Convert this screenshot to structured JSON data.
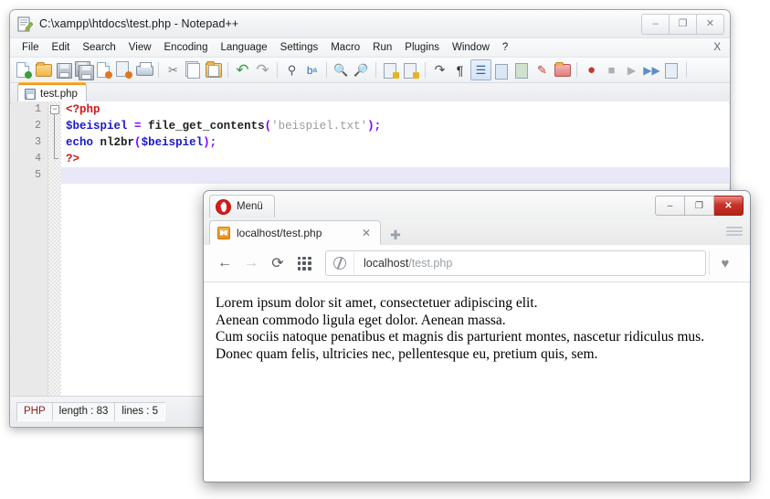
{
  "notepad": {
    "title": "C:\\xampp\\htdocs\\test.php - Notepad++",
    "app_icon": "notepad-plus-plus-icon",
    "window_controls": {
      "minimize": "–",
      "maximize": "❐",
      "close": "✕"
    },
    "menu": [
      {
        "label": "File"
      },
      {
        "label": "Edit"
      },
      {
        "label": "Search"
      },
      {
        "label": "View"
      },
      {
        "label": "Encoding"
      },
      {
        "label": "Language"
      },
      {
        "label": "Settings"
      },
      {
        "label": "Macro"
      },
      {
        "label": "Run"
      },
      {
        "label": "Plugins"
      },
      {
        "label": "Window"
      },
      {
        "label": "?"
      }
    ],
    "menu_close_label": "X",
    "toolbar_icons": [
      "new-file-icon",
      "open-file-icon",
      "save-icon",
      "save-all-icon",
      "close-file-icon",
      "close-all-files-icon",
      "print-icon",
      "cut-icon",
      "copy-icon",
      "paste-icon",
      "undo-icon",
      "redo-icon",
      "find-icon",
      "replace-icon",
      "zoom-in-icon",
      "zoom-out-icon",
      "sync-vertical-scroll-icon",
      "sync-horizontal-scroll-icon",
      "word-wrap-icon",
      "show-all-characters-icon",
      "indent-guide-icon",
      "user-defined-dialog-icon",
      "show-document-map-icon",
      "function-list-icon",
      "folder-as-workspace-icon",
      "record-macro-icon",
      "stop-recording-icon",
      "play-macro-icon",
      "run-macro-multiple-icon",
      "save-macro-icon"
    ],
    "tabs": [
      {
        "label": "test.php",
        "icon": "saved-file-icon",
        "active": true
      }
    ],
    "editor": {
      "line_numbers": [
        "1",
        "2",
        "3",
        "4",
        "5"
      ],
      "fold_marker": "−",
      "lines": [
        {
          "n": 1,
          "tokens": [
            {
              "t": "<?php",
              "c": "c-tag"
            }
          ]
        },
        {
          "n": 2,
          "tokens": [
            {
              "t": "$beispiel",
              "c": "c-var"
            },
            {
              "t": " ",
              "c": "c-plain"
            },
            {
              "t": "=",
              "c": "c-op"
            },
            {
              "t": " ",
              "c": "c-plain"
            },
            {
              "t": "file_get_contents",
              "c": "c-fn"
            },
            {
              "t": "(",
              "c": "c-punc"
            },
            {
              "t": "'beispiel.txt'",
              "c": "c-str"
            },
            {
              "t": ")",
              "c": "c-punc"
            },
            {
              "t": ";",
              "c": "c-punc"
            }
          ]
        },
        {
          "n": 3,
          "tokens": [
            {
              "t": "echo",
              "c": "c-kw"
            },
            {
              "t": " ",
              "c": "c-plain"
            },
            {
              "t": "nl2br",
              "c": "c-fn"
            },
            {
              "t": "(",
              "c": "c-punc"
            },
            {
              "t": "$beispiel",
              "c": "c-var"
            },
            {
              "t": ")",
              "c": "c-punc"
            },
            {
              "t": ";",
              "c": "c-punc"
            }
          ]
        },
        {
          "n": 4,
          "tokens": [
            {
              "t": "?>",
              "c": "c-tag"
            }
          ]
        },
        {
          "n": 5,
          "tokens": [],
          "current": true
        }
      ]
    },
    "status_bar": {
      "language": "PHP",
      "length": "length : 83",
      "lines": "lines : 5"
    }
  },
  "opera": {
    "menu_button_label": "Menü",
    "logo_icon": "opera-logo-icon",
    "window_controls": {
      "minimize": "–",
      "maximize": "❐",
      "close": "✕"
    },
    "tabs": [
      {
        "title": "localhost/test.php",
        "favicon": "page-icon",
        "close_label": "✕"
      }
    ],
    "new_tab_label": "✚",
    "tab_menu_icon": "tab-menu-icon",
    "nav": {
      "back_label": "←",
      "back_icon": "back-arrow-icon",
      "forward_label": "→",
      "forward_icon": "forward-arrow-icon",
      "reload_label": "⟳",
      "reload_icon": "reload-icon",
      "speeddial_icon": "speed-dial-icon"
    },
    "address_bar": {
      "security_icon": "globe-icon",
      "host": "localhost",
      "path": "/test.php",
      "bookmark_icon": "heart-icon",
      "bookmark_label": "♥"
    },
    "page_content": [
      "Lorem ipsum dolor sit amet, consectetuer adipiscing elit.",
      "Aenean commodo ligula eget dolor. Aenean massa.",
      "Cum sociis natoque penatibus et magnis dis parturient montes, nascetur ridiculus mus.",
      "Donec quam felis, ultricies nec, pellentesque eu, pretium quis, sem."
    ]
  },
  "colors": {
    "accent_orange": "#f08a15",
    "opera_red": "#c93228",
    "php_tag_red": "#d01a1a",
    "variable_blue": "#1818c8",
    "operator_purple": "#8000ff",
    "string_grey": "#9b9b9b",
    "current_line": "#e8e8f8"
  }
}
